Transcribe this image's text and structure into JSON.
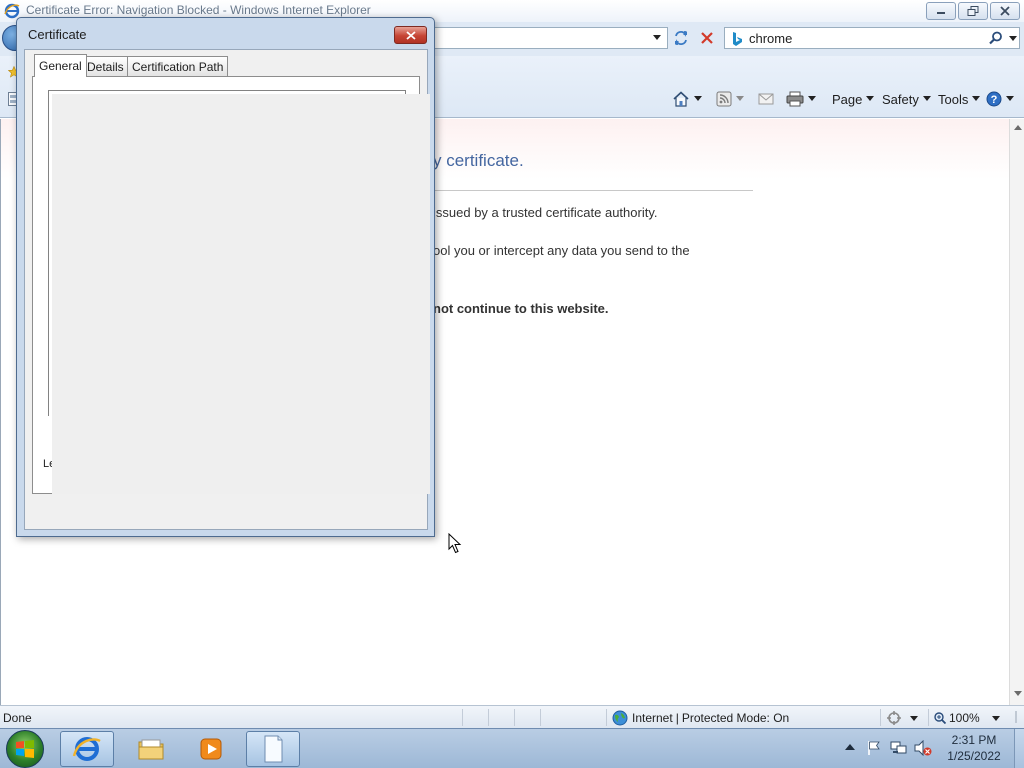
{
  "window": {
    "title": "Certificate Error: Navigation Blocked - Windows Internet Explorer"
  },
  "search": {
    "value": "chrome"
  },
  "command_bar": {
    "page_label": "Page",
    "safety_label": "Safety",
    "tools_label": "Tools"
  },
  "content": {
    "heading_fragment": "y certificate.",
    "line_1_fragment": "issued by a trusted certificate authority.",
    "line_2_fragment": "ool you or intercept any data you send to the",
    "recommendation_fragment": "not continue to this website."
  },
  "status_bar": {
    "status": "Done",
    "zone": "Internet",
    "separator": "|",
    "protected_mode": "Protected Mode: On",
    "zoom": "100%"
  },
  "certificate_dialog": {
    "title": "Certificate",
    "tabs": [
      "General",
      "Details",
      "Certification Path"
    ],
    "active_tab": "General",
    "learn_more_fragment": "Le"
  },
  "taskbar": {
    "clock_time": "2:31 PM",
    "clock_date": "1/25/2022"
  },
  "icons": {
    "title": "ie-icon",
    "back": "back-arrow-icon",
    "refresh": "refresh-icon",
    "stop": "stop-icon",
    "search": "search-icon",
    "home": "home-icon",
    "feeds": "feeds-icon",
    "mail": "read-mail-icon",
    "print": "print-icon",
    "help": "help-icon",
    "zone": "globe-icon",
    "zoom": "zoom-icon"
  },
  "colors": {
    "heading_blue": "#4466a0",
    "dialog_frame": "#c9d9ec",
    "close_red": "#c64535",
    "taskbar": "#a6c3e2"
  }
}
